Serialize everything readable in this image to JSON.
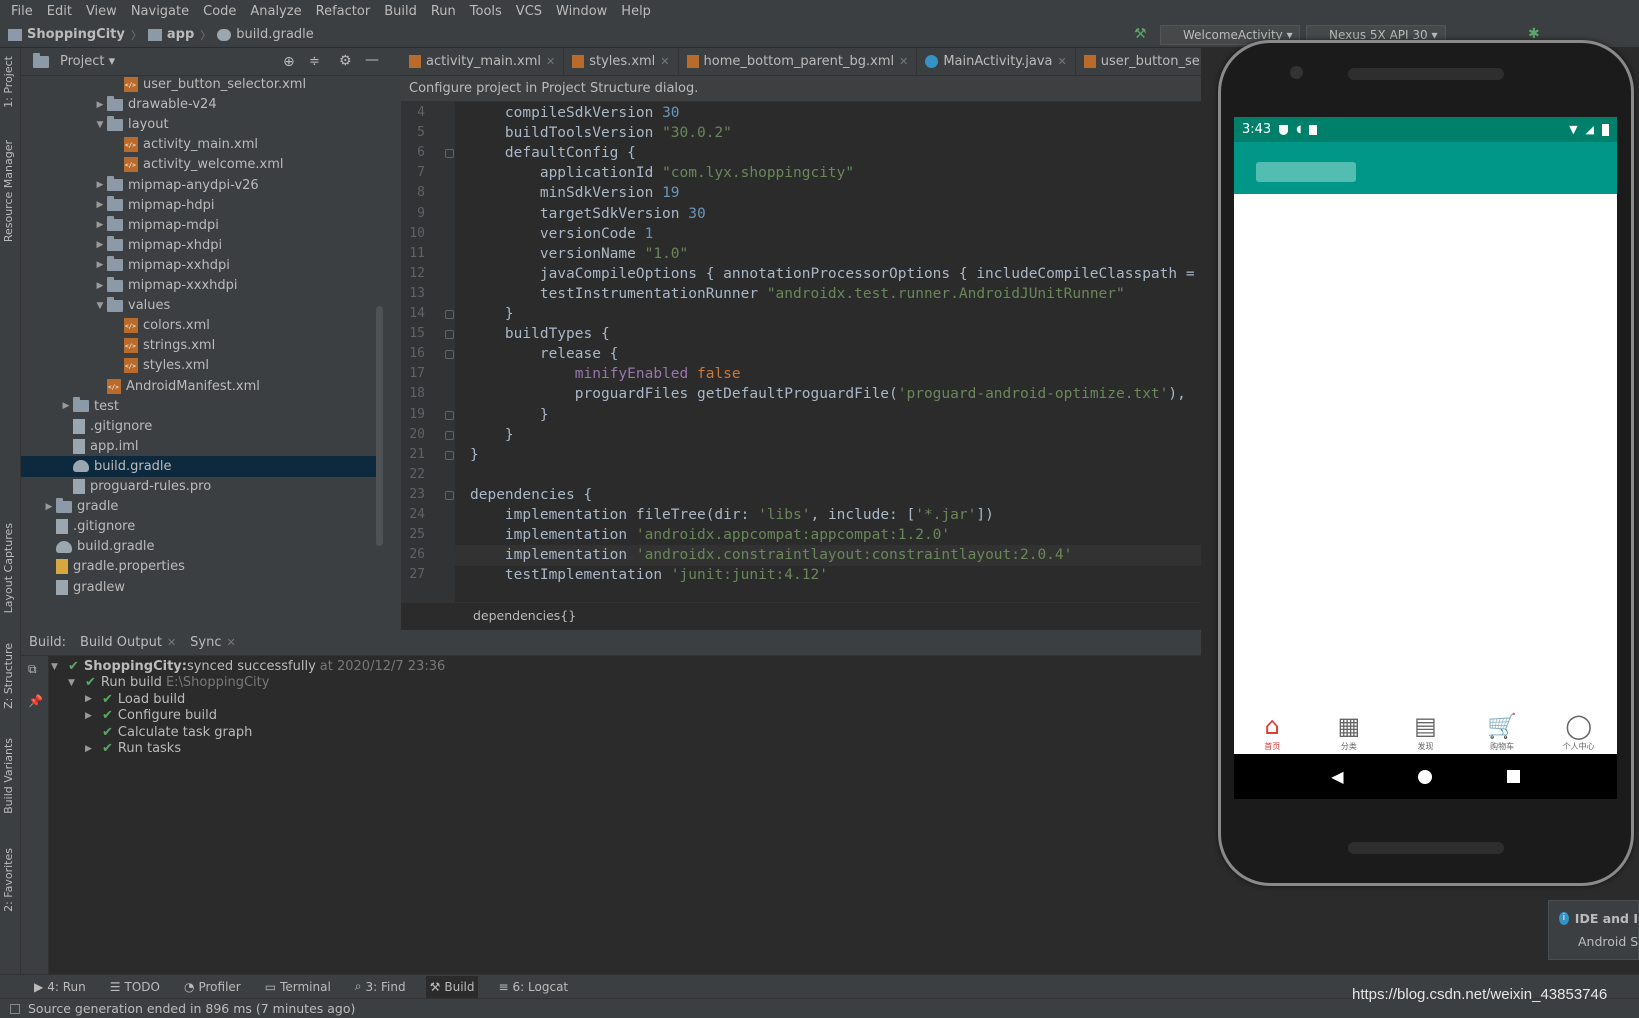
{
  "menu": [
    "File",
    "Edit",
    "View",
    "Navigate",
    "Code",
    "Analyze",
    "Refactor",
    "Build",
    "Run",
    "Tools",
    "VCS",
    "Window",
    "Help"
  ],
  "breadcrumb": {
    "project": "ShoppingCity",
    "module": "app",
    "file": "build.gradle"
  },
  "run_config": {
    "activity": "WelcomeActivity",
    "device": "Nexus 5X API 30"
  },
  "left_strip": {
    "project": "1: Project",
    "resource_manager": "Resource Manager",
    "layout_captures": "Layout Captures",
    "structure": "Z: Structure",
    "build_variants": "Build Variants",
    "favorites": "2: Favorites"
  },
  "project_panel": {
    "title": "Project",
    "tree": [
      {
        "label": "user_button_selector.xml",
        "kind": "xml",
        "indent": 5
      },
      {
        "label": "drawable-v24",
        "kind": "folder",
        "indent": 4,
        "arrow": "▶"
      },
      {
        "label": "layout",
        "kind": "folder",
        "indent": 4,
        "arrow": "▼"
      },
      {
        "label": "activity_main.xml",
        "kind": "xml",
        "indent": 5
      },
      {
        "label": "activity_welcome.xml",
        "kind": "xml",
        "indent": 5
      },
      {
        "label": "mipmap-anydpi-v26",
        "kind": "folder",
        "indent": 4,
        "arrow": "▶"
      },
      {
        "label": "mipmap-hdpi",
        "kind": "folder",
        "indent": 4,
        "arrow": "▶"
      },
      {
        "label": "mipmap-mdpi",
        "kind": "folder",
        "indent": 4,
        "arrow": "▶"
      },
      {
        "label": "mipmap-xhdpi",
        "kind": "folder",
        "indent": 4,
        "arrow": "▶"
      },
      {
        "label": "mipmap-xxhdpi",
        "kind": "folder",
        "indent": 4,
        "arrow": "▶"
      },
      {
        "label": "mipmap-xxxhdpi",
        "kind": "folder",
        "indent": 4,
        "arrow": "▶"
      },
      {
        "label": "values",
        "kind": "folder",
        "indent": 4,
        "arrow": "▼"
      },
      {
        "label": "colors.xml",
        "kind": "xml",
        "indent": 5
      },
      {
        "label": "strings.xml",
        "kind": "xml",
        "indent": 5
      },
      {
        "label": "styles.xml",
        "kind": "xml",
        "indent": 5
      },
      {
        "label": "AndroidManifest.xml",
        "kind": "xml",
        "indent": 4
      },
      {
        "label": "test",
        "kind": "folder",
        "indent": 2,
        "arrow": "▶"
      },
      {
        "label": ".gitignore",
        "kind": "txt",
        "indent": 2
      },
      {
        "label": "app.iml",
        "kind": "txt",
        "indent": 2
      },
      {
        "label": "build.gradle",
        "kind": "gradle",
        "indent": 2,
        "selected": true
      },
      {
        "label": "proguard-rules.pro",
        "kind": "txt",
        "indent": 2
      },
      {
        "label": "gradle",
        "kind": "folder",
        "indent": 1,
        "arrow": "▶"
      },
      {
        "label": ".gitignore",
        "kind": "txt",
        "indent": 1
      },
      {
        "label": "build.gradle",
        "kind": "gradle",
        "indent": 1
      },
      {
        "label": "gradle.properties",
        "kind": "prop",
        "indent": 1
      },
      {
        "label": "gradlew",
        "kind": "txt",
        "indent": 1
      }
    ]
  },
  "editor": {
    "tabs": [
      {
        "label": "activity_main.xml",
        "icon": "xml"
      },
      {
        "label": "styles.xml",
        "icon": "xml"
      },
      {
        "label": "home_bottom_parent_bg.xml",
        "icon": "xml"
      },
      {
        "label": "MainActivity.java",
        "icon": "java"
      },
      {
        "label": "user_button_selector.xml",
        "icon": "xml"
      }
    ],
    "info": "Configure project in Project Structure dialog.",
    "current_line": 26,
    "lines": [
      {
        "n": "4",
        "segs": [
          [
            "",
            "    compileSdkVersion "
          ],
          [
            "num",
            "30"
          ]
        ]
      },
      {
        "n": "5",
        "segs": [
          [
            "",
            "    buildToolsVersion "
          ],
          [
            "str",
            "\"30.0.2\""
          ]
        ]
      },
      {
        "n": "6",
        "segs": [
          [
            "",
            "    defaultConfig {"
          ]
        ],
        "fold": true
      },
      {
        "n": "7",
        "segs": [
          [
            "",
            "        applicationId "
          ],
          [
            "str",
            "\"com.lyx.shoppingcity\""
          ]
        ]
      },
      {
        "n": "8",
        "segs": [
          [
            "",
            "        minSdkVersion "
          ],
          [
            "num",
            "19"
          ]
        ]
      },
      {
        "n": "9",
        "segs": [
          [
            "",
            "        targetSdkVersion "
          ],
          [
            "num",
            "30"
          ]
        ]
      },
      {
        "n": "10",
        "segs": [
          [
            "",
            "        versionCode "
          ],
          [
            "num",
            "1"
          ]
        ]
      },
      {
        "n": "11",
        "segs": [
          [
            "",
            "        versionName "
          ],
          [
            "str",
            "\"1.0\""
          ]
        ]
      },
      {
        "n": "12",
        "segs": [
          [
            "",
            "        javaCompileOptions { annotationProcessorOptions { includeCompileClasspath ="
          ]
        ]
      },
      {
        "n": "13",
        "segs": [
          [
            "",
            "        testInstrumentationRunner "
          ],
          [
            "str",
            "\"androidx.test.runner.AndroidJUnitRunner\""
          ]
        ]
      },
      {
        "n": "14",
        "segs": [
          [
            "",
            "    }"
          ]
        ],
        "fold": true
      },
      {
        "n": "15",
        "segs": [
          [
            "",
            "    buildTypes {"
          ]
        ],
        "fold": true
      },
      {
        "n": "16",
        "segs": [
          [
            "",
            "        release {"
          ]
        ],
        "fold": true
      },
      {
        "n": "17",
        "segs": [
          [
            "",
            "            "
          ],
          [
            "prop",
            "minifyEnabled "
          ],
          [
            "kw",
            "false"
          ]
        ]
      },
      {
        "n": "18",
        "segs": [
          [
            "",
            "            proguardFiles getDefaultProguardFile("
          ],
          [
            "str",
            "'proguard-android-optimize.txt'"
          ],
          [
            "",
            "),"
          ]
        ]
      },
      {
        "n": "19",
        "segs": [
          [
            "",
            "        }"
          ]
        ],
        "fold": true
      },
      {
        "n": "20",
        "segs": [
          [
            "",
            "    }"
          ]
        ],
        "fold": true
      },
      {
        "n": "21",
        "segs": [
          [
            "",
            "}"
          ]
        ],
        "fold": true
      },
      {
        "n": "22",
        "segs": [
          [
            "",
            ""
          ]
        ]
      },
      {
        "n": "23",
        "segs": [
          [
            "",
            "dependencies {"
          ]
        ],
        "fold": true
      },
      {
        "n": "24",
        "segs": [
          [
            "",
            "    implementation fileTree(dir: "
          ],
          [
            "str",
            "'libs'"
          ],
          [
            "",
            ", include: ["
          ],
          [
            "str",
            "'*.jar'"
          ],
          [
            "",
            "])"
          ]
        ]
      },
      {
        "n": "25",
        "segs": [
          [
            "",
            "    implementation "
          ],
          [
            "str",
            "'androidx.appcompat:appcompat:1.2.0'"
          ]
        ]
      },
      {
        "n": "26",
        "segs": [
          [
            "",
            "    implementation "
          ],
          [
            "str",
            "'androidx.constraintlayout:constraintlayout:2.0.4'"
          ]
        ]
      },
      {
        "n": "27",
        "segs": [
          [
            "",
            "    testImplementation "
          ],
          [
            "str",
            "'junit:junit:4.12'"
          ]
        ]
      }
    ],
    "crumb": "dependencies{}"
  },
  "build": {
    "label": "Build:",
    "tabs": [
      "Build Output",
      "Sync"
    ],
    "rows": [
      {
        "bold": "ShoppingCity:",
        "text": " synced successfully",
        "muted": "at 2020/12/7 23:36",
        "indent": 0,
        "arrow": "▼"
      },
      {
        "text": "Run build",
        "muted": "E:\\ShoppingCity",
        "indent": 1,
        "arrow": "▼"
      },
      {
        "text": "Load build",
        "indent": 2,
        "arrow": "▶"
      },
      {
        "text": "Configure build",
        "indent": 2,
        "arrow": "▶"
      },
      {
        "text": "Calculate task graph",
        "indent": 2,
        "arrow": ""
      },
      {
        "text": "Run tasks",
        "indent": 2,
        "arrow": "▶"
      }
    ]
  },
  "bottom_tools": [
    {
      "label": "4: Run"
    },
    {
      "label": "TODO"
    },
    {
      "label": "Profiler"
    },
    {
      "label": "Terminal"
    },
    {
      "label": "3: Find"
    },
    {
      "label": "Build",
      "active": true
    },
    {
      "label": "6: Logcat"
    }
  ],
  "status": "Source generation ended in 896 ms (7 minutes ago)",
  "emulator": {
    "time": "3:43",
    "colors": {
      "status_bar": "#00806b",
      "app_bar": "#009688",
      "active_tab": "#e53935"
    },
    "nav": [
      {
        "label": "首页",
        "icon": "home-icon",
        "active": true
      },
      {
        "label": "分类",
        "icon": "grid-search-icon"
      },
      {
        "label": "发现",
        "icon": "calendar-icon"
      },
      {
        "label": "购物车",
        "icon": "cart-icon"
      },
      {
        "label": "个人中心",
        "icon": "person-icon"
      }
    ]
  },
  "notification": {
    "title": "IDE and I",
    "body": "Android S"
  },
  "watermark": "https://blog.csdn.net/weixin_43853746"
}
